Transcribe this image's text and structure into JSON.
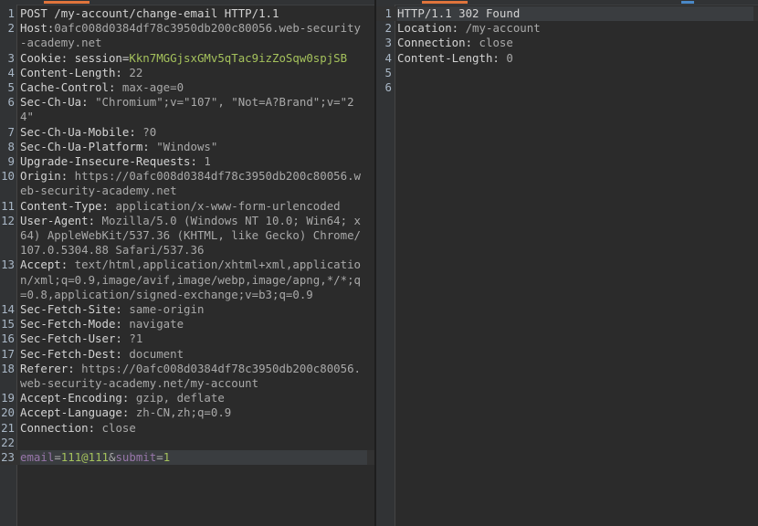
{
  "request": {
    "lines": [
      {
        "num": "1",
        "key": "POST /my-account/change-email HTTP/1.1",
        "sep": "",
        "val": ""
      },
      {
        "num": "2",
        "key": "Host:",
        "sep": "",
        "val": "0afc008d0384df78c3950db200c80056.web-security-academy.net"
      },
      {
        "num": "3",
        "key": "Cookie:",
        "sep": " session=",
        "val": "Kkn7MGGjsxGMv5qTac9izZoSqw0spjSB",
        "type": "cookie"
      },
      {
        "num": "4",
        "key": "Content-Length:",
        "sep": "",
        "val": " 22"
      },
      {
        "num": "5",
        "key": "Cache-Control:",
        "sep": "",
        "val": " max-age=0"
      },
      {
        "num": "6",
        "key": "Sec-Ch-Ua:",
        "sep": "",
        "val": " \"Chromium\";v=\"107\", \"Not=A?Brand\";v=\"24\""
      },
      {
        "num": "7",
        "key": "Sec-Ch-Ua-Mobile:",
        "sep": "",
        "val": " ?0"
      },
      {
        "num": "8",
        "key": "Sec-Ch-Ua-Platform:",
        "sep": "",
        "val": " \"Windows\""
      },
      {
        "num": "9",
        "key": "Upgrade-Insecure-Requests:",
        "sep": "",
        "val": " 1"
      },
      {
        "num": "10",
        "key": "Origin:",
        "sep": "",
        "val": " https://0afc008d0384df78c3950db200c80056.web-security-academy.net"
      },
      {
        "num": "11",
        "key": "Content-Type:",
        "sep": "",
        "val": " application/x-www-form-urlencoded"
      },
      {
        "num": "12",
        "key": "User-Agent:",
        "sep": "",
        "val": " Mozilla/5.0 (Windows NT 10.0; Win64; x64) AppleWebKit/537.36 (KHTML, like Gecko) Chrome/107.0.5304.88 Safari/537.36"
      },
      {
        "num": "13",
        "key": "Accept:",
        "sep": "",
        "val": " text/html,application/xhtml+xml,application/xml;q=0.9,image/avif,image/webp,image/apng,*/*;q=0.8,application/signed-exchange;v=b3;q=0.9"
      },
      {
        "num": "14",
        "key": "Sec-Fetch-Site:",
        "sep": "",
        "val": " same-origin"
      },
      {
        "num": "15",
        "key": "Sec-Fetch-Mode:",
        "sep": "",
        "val": " navigate"
      },
      {
        "num": "16",
        "key": "Sec-Fetch-User:",
        "sep": "",
        "val": " ?1"
      },
      {
        "num": "17",
        "key": "Sec-Fetch-Dest:",
        "sep": "",
        "val": " document"
      },
      {
        "num": "18",
        "key": "Referer:",
        "sep": "",
        "val": " https://0afc008d0384df78c3950db200c80056.web-security-academy.net/my-account"
      },
      {
        "num": "19",
        "key": "Accept-Encoding:",
        "sep": "",
        "val": " gzip, deflate"
      },
      {
        "num": "20",
        "key": "Accept-Language:",
        "sep": "",
        "val": " zh-CN,zh;q=0.9"
      },
      {
        "num": "21",
        "key": "Connection:",
        "sep": "",
        "val": " close"
      },
      {
        "num": "22",
        "key": "",
        "sep": "",
        "val": ""
      },
      {
        "num": "23",
        "key": "",
        "sep": "",
        "val": "",
        "type": "body",
        "body": [
          {
            "k": "email",
            "v": "111@111"
          },
          {
            "k": "submit",
            "v": "1"
          }
        ]
      }
    ]
  },
  "response": {
    "lines": [
      {
        "num": "1",
        "key": "HTTP/1.1 302 Found",
        "sep": "",
        "val": ""
      },
      {
        "num": "2",
        "key": "Location:",
        "sep": "",
        "val": " /my-account"
      },
      {
        "num": "3",
        "key": "Connection:",
        "sep": "",
        "val": " close"
      },
      {
        "num": "4",
        "key": "Content-Length:",
        "sep": "",
        "val": " 0"
      },
      {
        "num": "5",
        "key": "",
        "sep": "",
        "val": ""
      },
      {
        "num": "6",
        "key": "",
        "sep": "",
        "val": ""
      }
    ]
  }
}
